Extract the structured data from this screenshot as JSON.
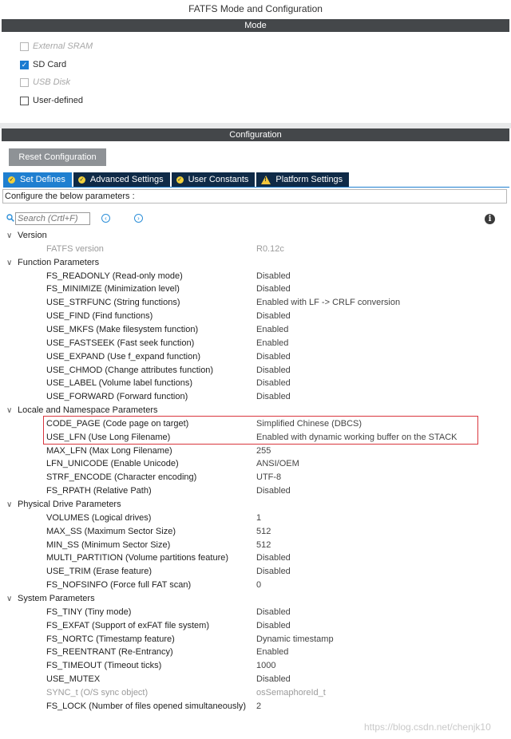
{
  "window": {
    "title": "FATFS Mode and Configuration"
  },
  "mode": {
    "header": "Mode",
    "items": [
      {
        "label": "External SRAM",
        "checked": false,
        "disabled": true
      },
      {
        "label": "SD Card",
        "checked": true,
        "disabled": false
      },
      {
        "label": "USB Disk",
        "checked": false,
        "disabled": true
      },
      {
        "label": "User-defined",
        "checked": false,
        "disabled": false
      }
    ]
  },
  "config": {
    "header": "Configuration",
    "reset_label": "Reset Configuration",
    "tabs": [
      {
        "label": "Set Defines",
        "icon": "check-circle-icon",
        "active": true
      },
      {
        "label": "Advanced Settings",
        "icon": "check-circle-icon",
        "active": false
      },
      {
        "label": "User Constants",
        "icon": "check-circle-icon",
        "active": false
      },
      {
        "label": "Platform Settings",
        "icon": "warning-icon",
        "active": false
      }
    ],
    "configure_text": "Configure the below parameters :",
    "search_placeholder": "Search (Crtl+F)",
    "groups": [
      {
        "name": "Version",
        "params": [
          {
            "name": "FATFS version",
            "value": "R0.12c",
            "disabled": true
          }
        ]
      },
      {
        "name": "Function Parameters",
        "params": [
          {
            "name": "FS_READONLY (Read-only mode)",
            "value": "Disabled"
          },
          {
            "name": "FS_MINIMIZE (Minimization level)",
            "value": "Disabled"
          },
          {
            "name": "USE_STRFUNC (String functions)",
            "value": "Enabled with LF -> CRLF conversion"
          },
          {
            "name": "USE_FIND (Find functions)",
            "value": "Disabled"
          },
          {
            "name": "USE_MKFS (Make filesystem function)",
            "value": "Enabled"
          },
          {
            "name": "USE_FASTSEEK (Fast seek function)",
            "value": "Enabled"
          },
          {
            "name": "USE_EXPAND (Use f_expand function)",
            "value": "Disabled"
          },
          {
            "name": "USE_CHMOD (Change attributes function)",
            "value": "Disabled"
          },
          {
            "name": "USE_LABEL (Volume label functions)",
            "value": "Disabled"
          },
          {
            "name": "USE_FORWARD (Forward function)",
            "value": "Disabled"
          }
        ]
      },
      {
        "name": "Locale and Namespace Parameters",
        "params": [
          {
            "name": "CODE_PAGE (Code page on target)",
            "value": "Simplified Chinese (DBCS)"
          },
          {
            "name": "USE_LFN (Use Long Filename)",
            "value": "Enabled with dynamic working buffer on the STACK"
          },
          {
            "name": "MAX_LFN (Max Long Filename)",
            "value": "255"
          },
          {
            "name": "LFN_UNICODE (Enable Unicode)",
            "value": "ANSI/OEM"
          },
          {
            "name": "STRF_ENCODE (Character encoding)",
            "value": "UTF-8"
          },
          {
            "name": "FS_RPATH (Relative Path)",
            "value": "Disabled"
          }
        ]
      },
      {
        "name": "Physical Drive Parameters",
        "params": [
          {
            "name": "VOLUMES (Logical drives)",
            "value": "1"
          },
          {
            "name": "MAX_SS (Maximum Sector Size)",
            "value": "512"
          },
          {
            "name": "MIN_SS (Minimum Sector Size)",
            "value": "512"
          },
          {
            "name": "MULTI_PARTITION (Volume partitions feature)",
            "value": "Disabled"
          },
          {
            "name": "USE_TRIM (Erase feature)",
            "value": "Disabled"
          },
          {
            "name": "FS_NOFSINFO (Force full FAT scan)",
            "value": "0"
          }
        ]
      },
      {
        "name": "System Parameters",
        "params": [
          {
            "name": "FS_TINY (Tiny mode)",
            "value": "Disabled"
          },
          {
            "name": "FS_EXFAT (Support of exFAT file system)",
            "value": "Disabled"
          },
          {
            "name": "FS_NORTC (Timestamp feature)",
            "value": "Dynamic timestamp"
          },
          {
            "name": "FS_REENTRANT (Re-Entrancy)",
            "value": "Enabled"
          },
          {
            "name": "FS_TIMEOUT (Timeout ticks)",
            "value": "1000"
          },
          {
            "name": "USE_MUTEX",
            "value": "Disabled"
          },
          {
            "name": "SYNC_t (O/S sync object)",
            "value": "osSemaphoreId_t",
            "disabled": true
          },
          {
            "name": "FS_LOCK (Number of files opened simultaneously)",
            "value": "2"
          }
        ]
      }
    ]
  },
  "watermark": "https://blog.csdn.net/chenjk10"
}
